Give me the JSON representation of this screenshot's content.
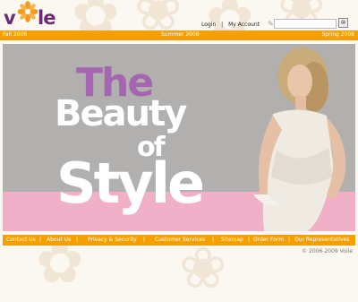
{
  "brand": {
    "logo_text_left": "v",
    "logo_text_right": "le"
  },
  "header": {
    "links": [
      "Login",
      "My Account"
    ],
    "separator": "|",
    "search": {
      "placeholder": "",
      "button": "⊗"
    }
  },
  "seasons": [
    "Fall 2008",
    "Summer 2008",
    "Spring 2008"
  ],
  "hero": {
    "word1": "The",
    "word2": "Beauty",
    "word3": "of",
    "word4": "Style"
  },
  "footer": {
    "links": [
      "Contact Us",
      "About Us",
      "Privacy & Security",
      "Customer Services",
      "Sitemap",
      "Order Form",
      "Our Representatives"
    ],
    "separator": "|",
    "copyright": "© 2006-2009 Voile"
  },
  "colors": {
    "accent": "#f5a000",
    "brand_purple": "#6b2a73",
    "hero_pink": "#efb0c8",
    "hero_grey": "#b1b0ae"
  }
}
